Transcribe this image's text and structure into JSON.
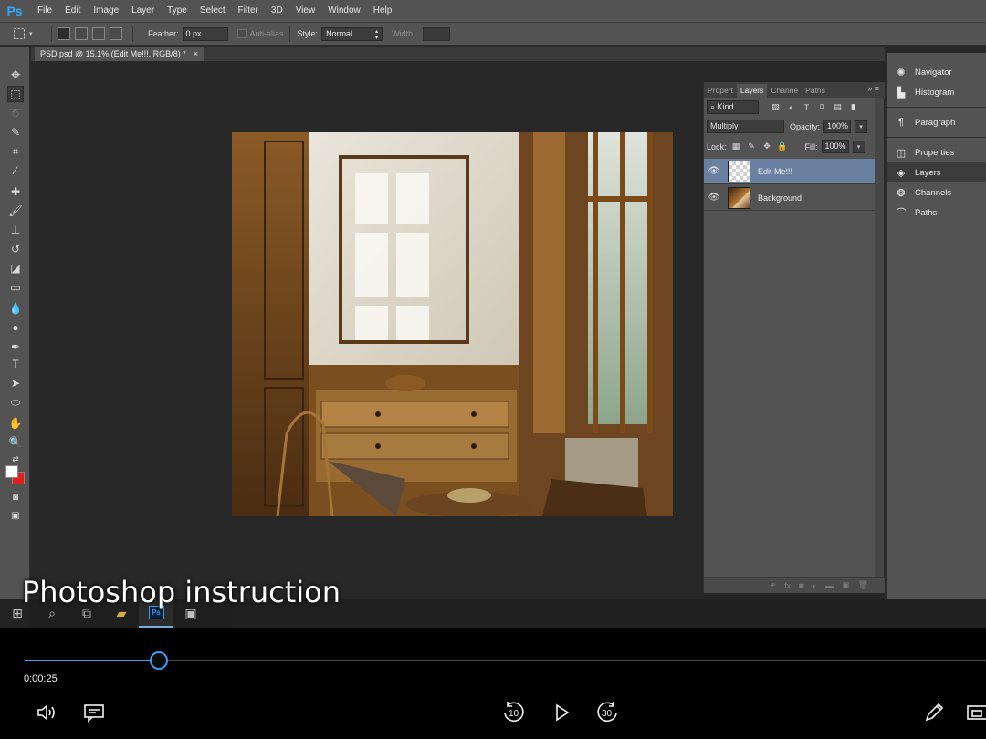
{
  "menu": {
    "logo": "Ps",
    "items": [
      "File",
      "Edit",
      "Image",
      "Layer",
      "Type",
      "Select",
      "Filter",
      "3D",
      "View",
      "Window",
      "Help"
    ]
  },
  "options": {
    "feather_label": "Feather:",
    "feather_value": "0 px",
    "antialias_label": "Anti-alias",
    "style_label": "Style:",
    "style_value": "Normal",
    "width_label": "Width:"
  },
  "document": {
    "tab_title": "PSD.psd @ 15.1% (Edit Me!!!, RGB/8) *",
    "tab_close": "×"
  },
  "layers_panel": {
    "tabs": [
      "Propert",
      "Layers",
      "Channe",
      "Paths"
    ],
    "active_tab": "Layers",
    "filter_kind": "Kind",
    "blend_mode": "Multiply",
    "opacity_label": "Opacity:",
    "opacity_value": "100%",
    "lock_label": "Lock:",
    "fill_label": "Fill:",
    "fill_value": "100%",
    "layers": [
      {
        "name": "Edit Me!!!",
        "selected": true
      },
      {
        "name": "Background",
        "selected": false
      }
    ]
  },
  "dock": {
    "items": [
      {
        "label": "Navigator",
        "icon": "navigator-icon"
      },
      {
        "label": "Histogram",
        "icon": "histogram-icon"
      },
      {
        "label": "Paragraph",
        "icon": "paragraph-icon"
      },
      {
        "label": "Properties",
        "icon": "properties-icon"
      },
      {
        "label": "Layers",
        "icon": "layers-icon"
      },
      {
        "label": "Channels",
        "icon": "channels-icon"
      },
      {
        "label": "Paths",
        "icon": "paths-icon"
      }
    ]
  },
  "caption": "Photoshop instruction",
  "player": {
    "time": "0:00:25",
    "progress_fraction": 0.14,
    "skip_back": "10",
    "skip_forward": "30",
    "accent_color": "#3b9cf5"
  },
  "colors": {
    "foreground": "#ffffff",
    "background": "#e01e1e",
    "selection_highlight": "#6a80a1"
  }
}
